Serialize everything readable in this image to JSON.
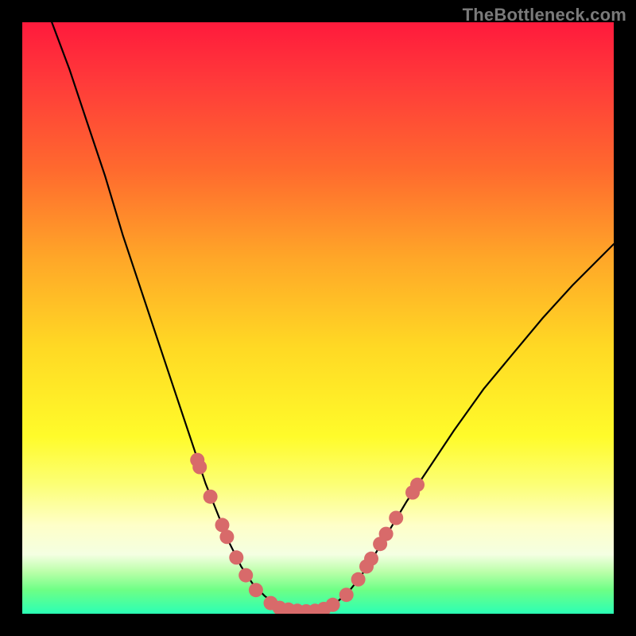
{
  "watermark": "TheBottleneck.com",
  "chart_data": {
    "type": "line",
    "title": "",
    "xlabel": "",
    "ylabel": "",
    "xlim": [
      0,
      1
    ],
    "ylim": [
      0,
      1
    ],
    "curve": [
      {
        "x": 0.05,
        "y": 1.0
      },
      {
        "x": 0.08,
        "y": 0.92
      },
      {
        "x": 0.11,
        "y": 0.83
      },
      {
        "x": 0.14,
        "y": 0.74
      },
      {
        "x": 0.17,
        "y": 0.64
      },
      {
        "x": 0.2,
        "y": 0.55
      },
      {
        "x": 0.23,
        "y": 0.46
      },
      {
        "x": 0.26,
        "y": 0.37
      },
      {
        "x": 0.29,
        "y": 0.28
      },
      {
        "x": 0.31,
        "y": 0.22
      },
      {
        "x": 0.33,
        "y": 0.17
      },
      {
        "x": 0.35,
        "y": 0.12
      },
      {
        "x": 0.37,
        "y": 0.08
      },
      {
        "x": 0.39,
        "y": 0.05
      },
      {
        "x": 0.41,
        "y": 0.03
      },
      {
        "x": 0.43,
        "y": 0.015
      },
      {
        "x": 0.45,
        "y": 0.008
      },
      {
        "x": 0.47,
        "y": 0.004
      },
      {
        "x": 0.49,
        "y": 0.004
      },
      {
        "x": 0.51,
        "y": 0.008
      },
      {
        "x": 0.53,
        "y": 0.018
      },
      {
        "x": 0.55,
        "y": 0.035
      },
      {
        "x": 0.57,
        "y": 0.06
      },
      {
        "x": 0.59,
        "y": 0.09
      },
      {
        "x": 0.62,
        "y": 0.14
      },
      {
        "x": 0.65,
        "y": 0.19
      },
      {
        "x": 0.69,
        "y": 0.25
      },
      {
        "x": 0.73,
        "y": 0.31
      },
      {
        "x": 0.78,
        "y": 0.38
      },
      {
        "x": 0.83,
        "y": 0.44
      },
      {
        "x": 0.88,
        "y": 0.5
      },
      {
        "x": 0.93,
        "y": 0.555
      },
      {
        "x": 0.98,
        "y": 0.605
      },
      {
        "x": 1.0,
        "y": 0.625
      }
    ],
    "dots": [
      {
        "x": 0.296,
        "y": 0.26
      },
      {
        "x": 0.3,
        "y": 0.248
      },
      {
        "x": 0.318,
        "y": 0.198
      },
      {
        "x": 0.338,
        "y": 0.15
      },
      {
        "x": 0.346,
        "y": 0.13
      },
      {
        "x": 0.362,
        "y": 0.095
      },
      {
        "x": 0.378,
        "y": 0.065
      },
      {
        "x": 0.395,
        "y": 0.04
      },
      {
        "x": 0.42,
        "y": 0.018
      },
      {
        "x": 0.435,
        "y": 0.01
      },
      {
        "x": 0.45,
        "y": 0.007
      },
      {
        "x": 0.465,
        "y": 0.005
      },
      {
        "x": 0.48,
        "y": 0.004
      },
      {
        "x": 0.495,
        "y": 0.005
      },
      {
        "x": 0.51,
        "y": 0.008
      },
      {
        "x": 0.525,
        "y": 0.015
      },
      {
        "x": 0.548,
        "y": 0.032
      },
      {
        "x": 0.568,
        "y": 0.058
      },
      {
        "x": 0.582,
        "y": 0.08
      },
      {
        "x": 0.59,
        "y": 0.093
      },
      {
        "x": 0.605,
        "y": 0.118
      },
      {
        "x": 0.615,
        "y": 0.135
      },
      {
        "x": 0.632,
        "y": 0.162
      },
      {
        "x": 0.66,
        "y": 0.205
      },
      {
        "x": 0.668,
        "y": 0.218
      }
    ],
    "dot_color": "#d86a6a",
    "background_gradient": [
      "#ff1a3c",
      "#ffd924",
      "#2bffb5"
    ]
  }
}
